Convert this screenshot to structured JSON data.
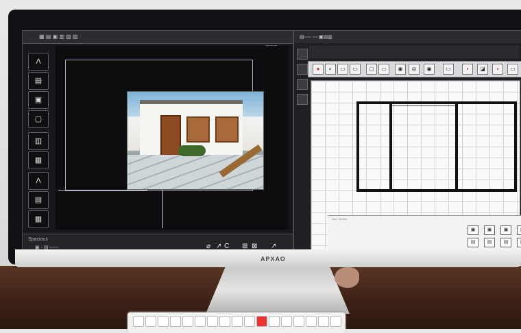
{
  "device": {
    "brand": "ΑΡΧΑΟ"
  },
  "left_app": {
    "menu_text": "▦ ▤ ▣ ▥ ▧ ▨",
    "canvas_tag": "⊡⊡⊡",
    "tools": [
      "Λ",
      "▤",
      "▣",
      "▢",
      "▥",
      "▦",
      "Λ",
      "▤",
      "▦"
    ],
    "status": {
      "label": "Spacious",
      "sublabel": "▣ ◦ ▤◦◦◦◦◦◦",
      "icons": [
        "⌀",
        "↗",
        "C",
        "⊞",
        "⊠",
        "↗"
      ]
    }
  },
  "right_app": {
    "title": "▤◦◦◦◦ ◦◦◦ ▣▤▥",
    "drawing_label": "◦◦◦ ◦◦◦◦◦"
  },
  "colors": {
    "screen_dark": "#16171a",
    "accent_brown": "#8d4a22",
    "drawing_bg": "#fafafa"
  }
}
